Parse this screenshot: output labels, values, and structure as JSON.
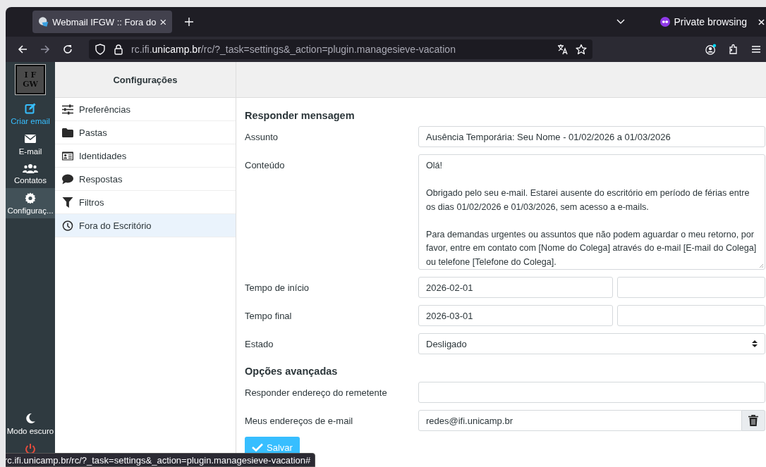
{
  "browser": {
    "tab_title": "Webmail IFGW :: Fora do",
    "private_label": "Private browsing",
    "url": {
      "prefix": "rc.ifi.",
      "domain": "unicamp.br",
      "path": "/rc/?_task=settings&_action=plugin.managesieve-vacation"
    },
    "status_url": "rc.ifi.unicamp.br/rc/?_task=settings&_action=plugin.managesieve-vacation#"
  },
  "rail": {
    "logo": [
      "I F",
      "GW"
    ],
    "items": [
      {
        "kind": "compose",
        "label": "Criar email",
        "selected": false
      },
      {
        "kind": "mail",
        "label": "E-mail",
        "selected": false
      },
      {
        "kind": "contacts",
        "label": "Contatos",
        "selected": false
      },
      {
        "kind": "settings",
        "label": "Configuraç...",
        "selected": true
      }
    ],
    "bottom": [
      {
        "kind": "darkmode",
        "label": "Modo escuro"
      },
      {
        "kind": "logout"
      }
    ]
  },
  "settings": {
    "title": "Configurações",
    "items": [
      {
        "kind": "sliders",
        "label": "Preferências",
        "selected": false
      },
      {
        "kind": "folder",
        "label": "Pastas",
        "selected": false
      },
      {
        "kind": "idcard",
        "label": "Identidades",
        "selected": false
      },
      {
        "kind": "bubble",
        "label": "Respostas",
        "selected": false
      },
      {
        "kind": "filter",
        "label": "Filtros",
        "selected": false
      },
      {
        "kind": "clock",
        "label": "Fora do Escritório",
        "selected": true
      }
    ]
  },
  "form": {
    "sections": [
      {
        "title": "Responder mensagem",
        "rows": [
          {
            "kind": "text",
            "label": "Assunto",
            "value": "Ausência Temporária: Seu Nome - 01/02/2026 a 01/03/2026"
          },
          {
            "kind": "textarea",
            "label": "Conteúdo",
            "value": "Olá!\n\nObrigado pelo seu e-mail. Estarei ausente do escritório em período de férias entre os dias 01/02/2026 e 01/03/2026, sem acesso a e-mails.\n\nPara demandas urgentes ou assuntos que não podem aguardar o meu retorno, por favor, entre em contato com [Nome do Colega] através do e-mail [E-mail do Colega] ou telefone [Telefone do Colega]."
          },
          {
            "kind": "datetime",
            "label": "Tempo de início",
            "value": "2026-02-01"
          },
          {
            "kind": "datetime",
            "label": "Tempo final",
            "value": "2026-03-01"
          },
          {
            "kind": "select",
            "label": "Estado",
            "value": "Desligado"
          }
        ]
      },
      {
        "title": "Opções avançadas",
        "rows": [
          {
            "kind": "text",
            "label": "Responder endereço do remetente"
          },
          {
            "kind": "list",
            "label": "Meus endereços de e-mail",
            "value": "redes@ifi.unicamp.br"
          }
        ]
      }
    ],
    "save_button": "Salvar"
  }
}
